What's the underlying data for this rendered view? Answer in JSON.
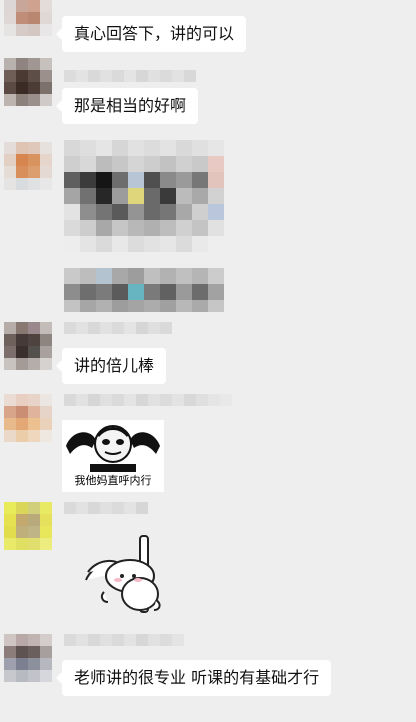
{
  "messages": [
    {
      "text": "真心回答下，讲的可以"
    },
    {
      "text": "那是相当的好啊"
    },
    {
      "text": "讲的倍儿棒"
    },
    {
      "sticker_caption": "我他妈直呼内行"
    },
    {
      "sticker": "bunny-sticker"
    },
    {
      "text": "老师讲的很专业 听课的有基础才行"
    }
  ],
  "colors": {
    "background": "#eeeeee",
    "bubble": "#ffffff",
    "text": "#111111"
  }
}
